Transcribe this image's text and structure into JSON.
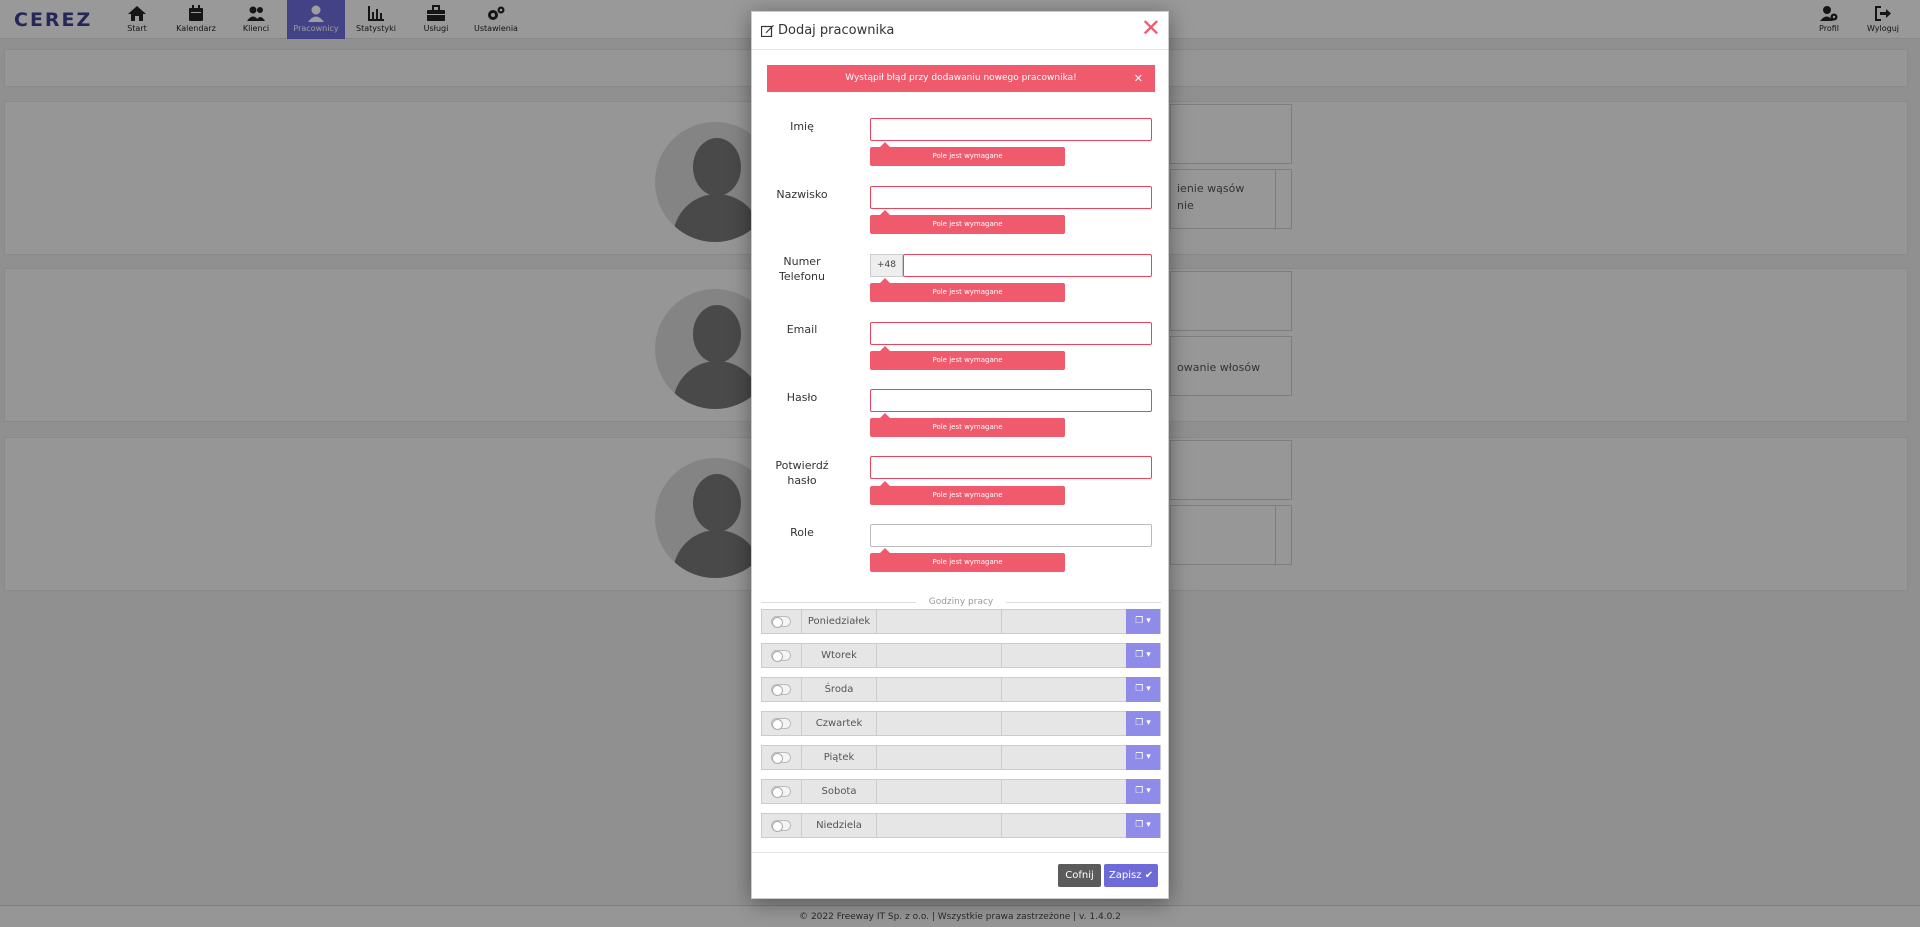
{
  "app": {
    "logo": "CEREZ"
  },
  "nav": {
    "items": [
      {
        "label": "Start",
        "icon": "home-icon"
      },
      {
        "label": "Kalendarz",
        "icon": "calendar-icon"
      },
      {
        "label": "Klienci",
        "icon": "users-icon"
      },
      {
        "label": "Pracownicy",
        "icon": "user-icon",
        "active": true
      },
      {
        "label": "Statystyki",
        "icon": "bar-chart-icon"
      },
      {
        "label": "Usługi",
        "icon": "briefcase-icon"
      },
      {
        "label": "Ustawienia",
        "icon": "gears-icon"
      }
    ],
    "right": [
      {
        "label": "Profil",
        "icon": "user-gear-icon"
      },
      {
        "label": "Wyloguj",
        "icon": "sign-out-icon"
      }
    ]
  },
  "background": {
    "box_texts": [
      "ienie wąsów",
      "nie",
      "owanie włosów"
    ]
  },
  "modal": {
    "title": "Dodaj pracownika",
    "error": "Wystąpił błąd przy dodawaniu nowego pracownika!",
    "fields": [
      {
        "label": "Imię",
        "value": "",
        "error": "Pole jest wymagane"
      },
      {
        "label": "Nazwisko",
        "value": "",
        "error": "Pole jest wymagane"
      },
      {
        "label": "Numer Telefonu",
        "prefix": "+48",
        "value": "",
        "error": "Pole jest wymagane"
      },
      {
        "label": "Email",
        "value": "",
        "error": "Pole jest wymagane"
      },
      {
        "label": "Hasło",
        "value": "",
        "error": "Pole jest wymagane"
      },
      {
        "label": "Potwierdź hasło",
        "value": "",
        "error": "Pole jest wymagane"
      },
      {
        "label": "Role",
        "value": "",
        "error": "Pole jest wymagane"
      }
    ],
    "hours_title": "Godziny pracy",
    "days": [
      "Poniedziałek",
      "Wtorek",
      "Środa",
      "Czwartek",
      "Piątek",
      "Sobota",
      "Niedziela"
    ],
    "back_label": "Cofnij",
    "save_label": "Zapisz",
    "colors": {
      "accent": "#6e6bd8",
      "error": "#f05a6d"
    }
  },
  "footer": {
    "text": "© 2022 Freeway IT Sp. z o.o. | Wszystkie prawa zastrzeżone | v. 1.4.0.2"
  }
}
